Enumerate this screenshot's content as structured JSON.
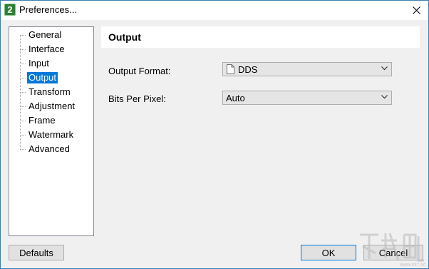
{
  "window": {
    "title": "Preferences..."
  },
  "sidebar": {
    "items": [
      {
        "label": "General"
      },
      {
        "label": "Interface"
      },
      {
        "label": "Input"
      },
      {
        "label": "Output"
      },
      {
        "label": "Transform"
      },
      {
        "label": "Adjustment"
      },
      {
        "label": "Frame"
      },
      {
        "label": "Watermark"
      },
      {
        "label": "Advanced"
      }
    ],
    "selected": "Output"
  },
  "content": {
    "title": "Output",
    "fields": [
      {
        "label": "Output Format:",
        "value": "DDS",
        "icon": "file-icon"
      },
      {
        "label": "Bits Per Pixel:",
        "value": "Auto"
      }
    ]
  },
  "footer": {
    "defaults_label": "Defaults",
    "ok_label": "OK",
    "cancel_label": "Cancel"
  },
  "colors": {
    "selection": "#0078d7",
    "border": "#3c7fb1"
  }
}
